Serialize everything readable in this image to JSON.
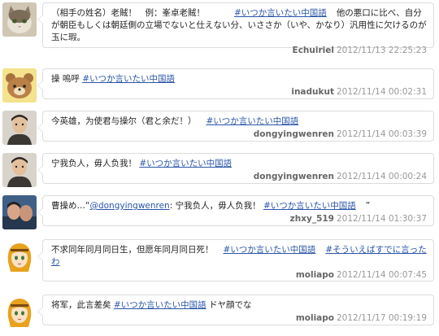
{
  "tweets": [
    {
      "text": "（相手の姓名）老賊！　例：峯卓老賊！",
      "hashtag": "#いつか言いたい中国語",
      "tail": "他の悪口に比べ、自分が朝臣もしくは朝廷側の立場でないと仕えない分、いささか（いや、かなり）汎用性に欠けるのが玉に瑕。",
      "user": "Echuiriel",
      "time": "2012/11/13 22:25:23",
      "avatar": "cat-avatar"
    },
    {
      "text": "操 嗚呼",
      "hashtag": "#いつか言いたい中国語",
      "user": "inadukut",
      "time": "2012/11/14 00:02:31",
      "avatar": "bear-avatar"
    },
    {
      "text": "今英雄，为使君与操尔（君と余だ！）",
      "hashtag": "#いつか言いたい中国語",
      "user": "dongyingwenren",
      "time": "2012/11/14 00:03:39",
      "avatar": "man-avatar"
    },
    {
      "text": "宁我负人，毋人负我！",
      "hashtag": "#いつか言いたい中国語",
      "user": "dongyingwenren",
      "time": "2012/11/14 00:00:24",
      "avatar": "man-avatar"
    },
    {
      "pre": "曹操め…“",
      "mention": "@dongyingwenren",
      "text": ": 宁我负人，毋人负我！",
      "hashtag": "#いつか言いたい中国語",
      "tail": "”",
      "user": "zhxy_519",
      "time": "2012/11/14 01:30:37",
      "avatar": "photo-avatar"
    },
    {
      "text": "不求同年同月同日生，但愿年同月同日死！",
      "hashtag": "#いつか言いたい中国語",
      "hashtag2": "#そういえばすでに言ったわ",
      "user": "moliapo",
      "time": "2012/11/14 00:07:45",
      "avatar": "anime-girl-avatar"
    },
    {
      "text": "将军，此言差矣",
      "hashtag": "#いつか言いたい中国語",
      "tail": "ドヤ顔でな",
      "user": "moliapo",
      "time": "2012/11/17 00:19:19",
      "avatar": "anime-girl-avatar"
    }
  ],
  "colors": {
    "link": "#2a55a8",
    "border": "#dcdcdc",
    "meta": "#999999"
  }
}
